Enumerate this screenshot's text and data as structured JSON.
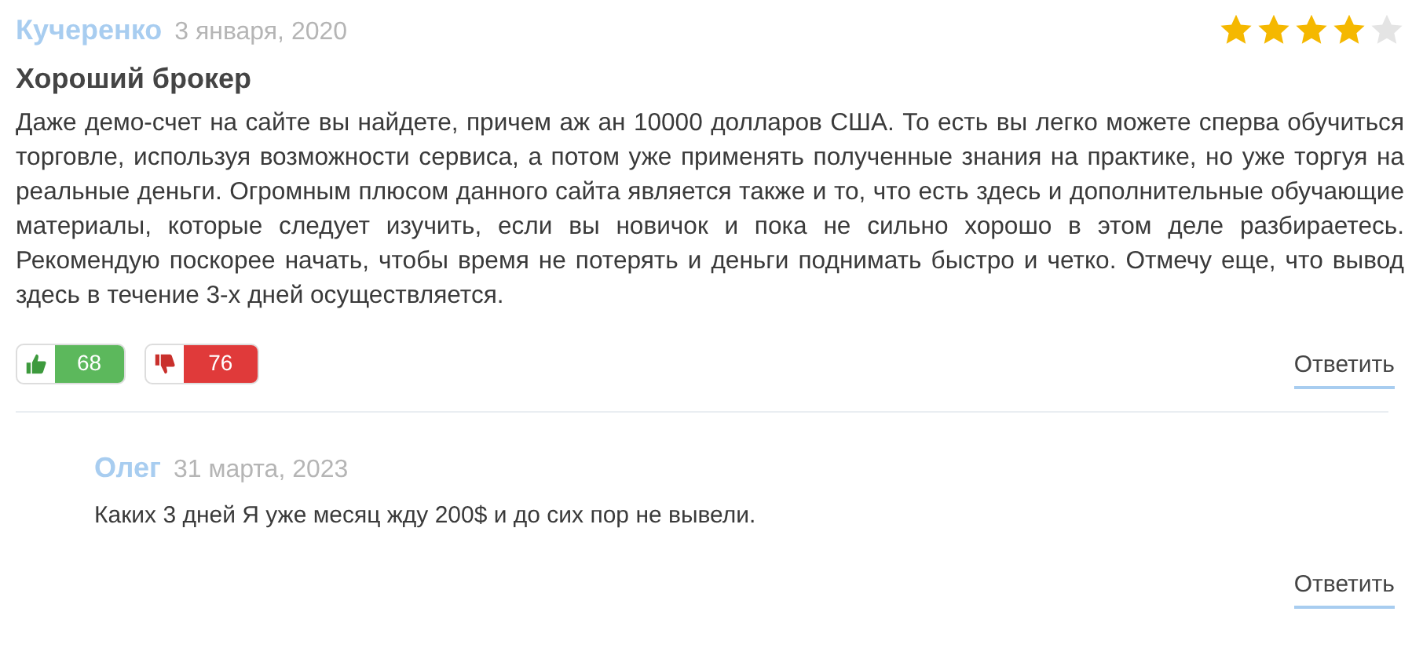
{
  "review": {
    "author": "Кучеренко",
    "date": "3 января, 2020",
    "stars": 4,
    "title": "Хороший брокер",
    "text": "Даже демо-счет на сайте вы найдете, причем аж ан 10000 долларов США. То есть вы легко можете сперва обучиться торговле, используя возможности сервиса, а потом уже применять полученные знания на практике, но уже торгуя на реальные деньги. Огромным плюсом данного сайта является также и то, что есть здесь и дополнительные обучающие материалы, которые следует изучить, если вы новичок и пока не сильно хорошо в этом деле разбираетесь. Рекомендую поскорее начать, чтобы время не потерять и деньги поднимать быстро и четко. Отмечу еще, что вывод здесь в течение 3-х дней осуществляется.",
    "likes": "68",
    "dislikes": "76",
    "reply_link": "Ответить"
  },
  "replies": [
    {
      "author": "Олег",
      "date": "31 марта, 2023",
      "text": "Каких 3 дней Я уже месяц жду 200$ и до сих пор не вывели.",
      "reply_link": "Ответить"
    }
  ]
}
